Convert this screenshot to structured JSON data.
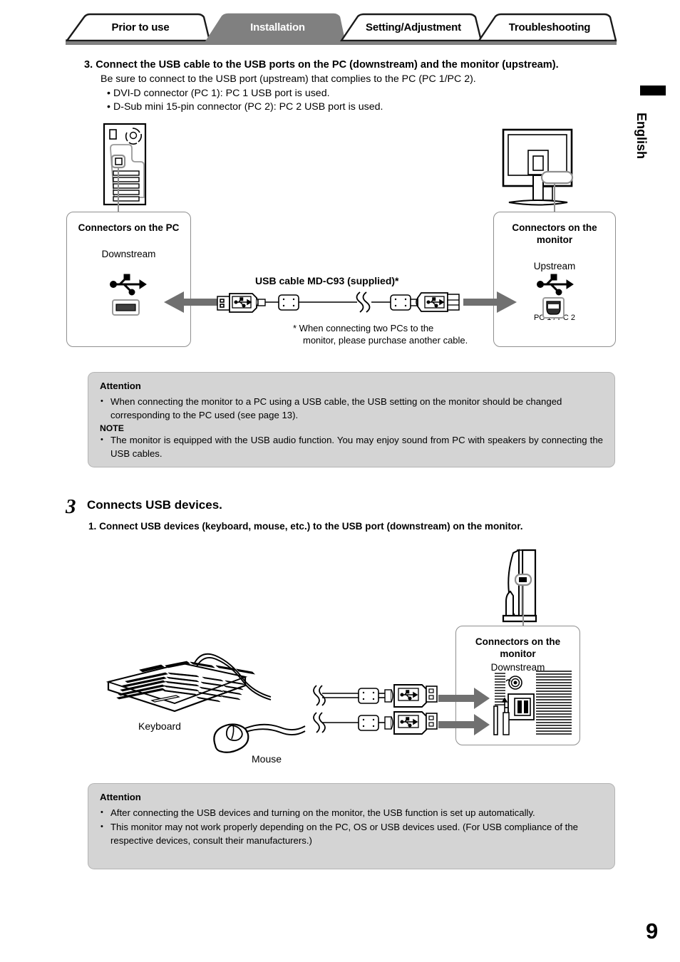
{
  "document": {
    "page_number": "9",
    "side_tab_label": "English"
  },
  "tabs": [
    {
      "label": "Prior to use",
      "active": false
    },
    {
      "label": "Installation",
      "active": true
    },
    {
      "label": "Setting/Adjustment",
      "active": false
    },
    {
      "label": "Troubleshooting",
      "active": false
    }
  ],
  "colors": {
    "tab_active_bg": "#808080",
    "tab_inactive_bg": "#ffffff",
    "tab_border": "#1a1a1a",
    "attention_bg": "#d4d4d4",
    "callout_border": "#8f8f8f",
    "arrow": "#707070"
  },
  "step3": {
    "heading": "3. Connect the USB cable to the USB ports on the PC (downstream) and the monitor (upstream).",
    "subtext": "Be sure to connect to the USB port (upstream) that complies to the PC (PC 1/PC 2).",
    "bullets": [
      "DVI-D connector (PC 1): PC 1 USB port is used.",
      "D-Sub mini 15-pin connector (PC 2): PC 2 USB port is used."
    ]
  },
  "diagram1": {
    "pc_callout": {
      "title": "Connectors on the PC",
      "subtitle": "Downstream",
      "usb_icon": "usb-icon",
      "port_icon": "usb-type-a-port-icon"
    },
    "monitor_callout": {
      "title": "Connectors on the monitor",
      "subtitle": "Upstream",
      "usb_icon": "usb-icon",
      "port_icon": "usb-type-b-port-icon",
      "footnote": "PC 1 / PC 2"
    },
    "cable_title": "USB cable MD-C93 (supplied)*",
    "cable_note": "* When connecting two PCs to the\nmonitor, please purchase another cable.",
    "cable_note_line1": "* When connecting two PCs to the",
    "cable_note_line2": "monitor, please purchase another cable.",
    "pc_illustration": "desktop-pc-tower-icon",
    "monitor_illustration": "monitor-rear-view-icon"
  },
  "attention1": {
    "heading": "Attention",
    "items": [
      "When connecting the monitor to a PC using a USB cable, the USB setting on the monitor should be changed corresponding to the PC used (see page 13)."
    ],
    "note_heading": "NOTE",
    "note_items": [
      "The monitor is equipped with the USB audio function. You may enjoy sound from PC with speakers by connecting the USB cables."
    ]
  },
  "section3": {
    "number": "3",
    "title": "Connects USB devices.",
    "step": "1. Connect USB devices (keyboard, mouse, etc.) to the USB port (downstream) on the monitor."
  },
  "diagram2": {
    "monitor_callout": {
      "title": "Connectors on the monitor",
      "subtitle": "Downstream",
      "port_illustration": "monitor-side-ports-icon"
    },
    "keyboard_label": "Keyboard",
    "mouse_label": "Mouse",
    "monitor_illustration": "monitor-side-view-icon",
    "keyboard_illustration": "keyboard-icon",
    "mouse_illustration": "mouse-icon"
  },
  "attention2": {
    "heading": "Attention",
    "items": [
      "After connecting the USB devices and turning on the monitor, the USB function is set up automatically.",
      "This monitor may not work properly depending on the PC, OS or USB devices used. (For USB compliance of the respective devices, consult their manufacturers.)"
    ]
  }
}
